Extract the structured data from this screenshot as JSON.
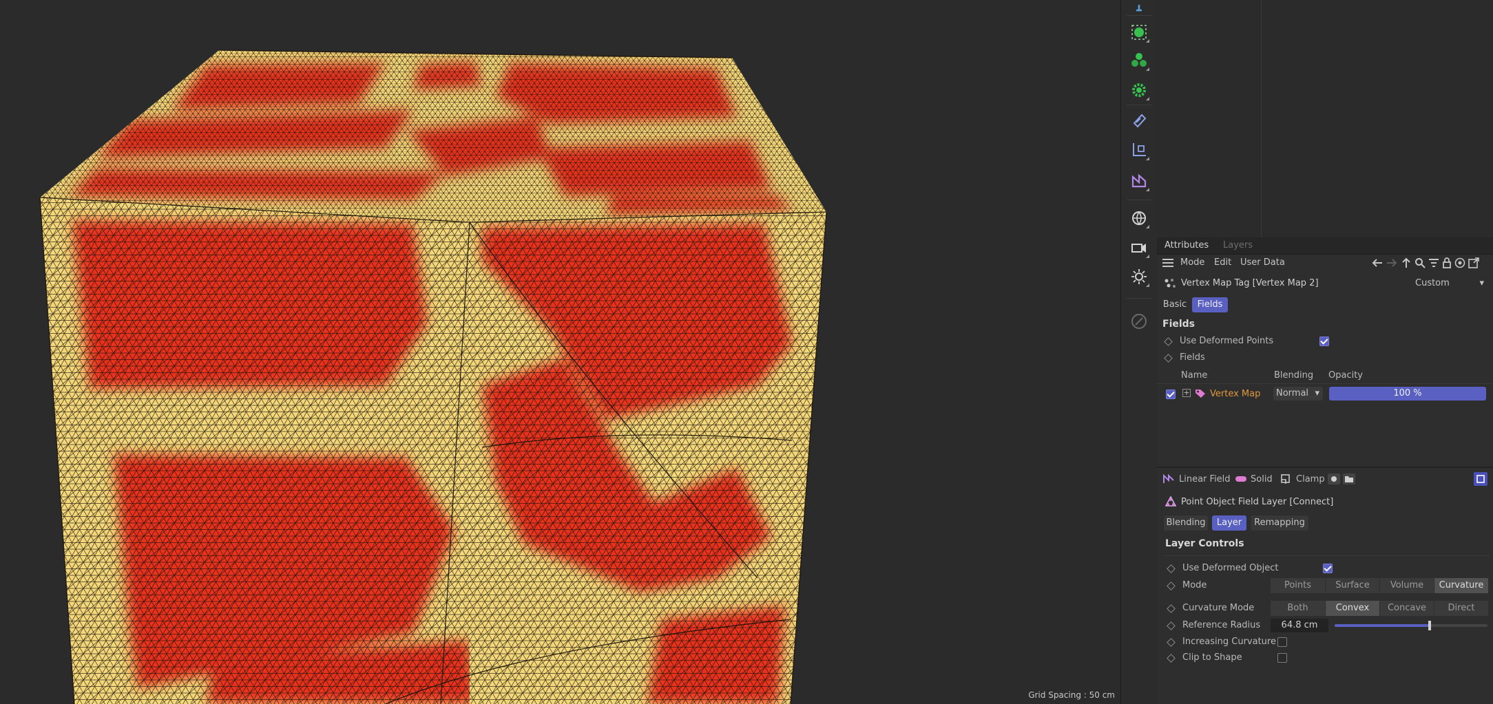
{
  "viewport": {
    "grid_label": "Grid Spacing : 50 cm"
  },
  "palette": {
    "icons": [
      "move-icon",
      "sphere-object-icon",
      "cloner-icon",
      "gear-icon",
      "shield-icon",
      "axis-icon",
      "deformer-icon",
      "globe-icon",
      "camera-icon",
      "light-icon",
      "brush-icon"
    ]
  },
  "attributes": {
    "tabs": {
      "attributes": "Attributes",
      "layers": "Layers"
    },
    "menu": {
      "mode": "Mode",
      "edit": "Edit",
      "user_data": "User Data"
    },
    "object_title": "Vertex Map Tag [Vertex Map 2]",
    "preset": "Custom",
    "subtabs": {
      "basic": "Basic",
      "fields": "Fields"
    },
    "fields_heading": "Fields",
    "use_deformed_points": "Use Deformed Points",
    "fields_label": "Fields",
    "table": {
      "col_name": "Name",
      "col_blending": "Blending",
      "col_opacity": "Opacity",
      "row_name": "Vertex Map",
      "row_blending": "Normal",
      "row_opacity": "100 %"
    },
    "layer_toolbar": {
      "linear_field": "Linear Field",
      "solid": "Solid",
      "clamp": "Clamp"
    },
    "layer_title": "Point Object Field Layer [Connect]",
    "layer_tabs": {
      "blending": "Blending",
      "layer": "Layer",
      "remapping": "Remapping"
    },
    "layer_controls": "Layer Controls",
    "use_deformed_object": "Use Deformed Object",
    "mode_label": "Mode",
    "mode_options": [
      "Points",
      "Surface",
      "Volume",
      "Curvature"
    ],
    "curvature_mode_label": "Curvature Mode",
    "curvature_options": [
      "Both",
      "Convex",
      "Concave",
      "Direct"
    ],
    "reference_radius_label": "Reference Radius",
    "reference_radius_value": "64.8 cm",
    "reference_radius_fraction": 0.62,
    "increasing_curvature": "Increasing Curvature",
    "clip_to_shape": "Clip to Shape"
  },
  "colors": {
    "accent": "#5a5fc2",
    "mesh_red": "#e8321a",
    "mesh_yellow": "#f3d77a",
    "field_orange": "#e39a3a"
  }
}
